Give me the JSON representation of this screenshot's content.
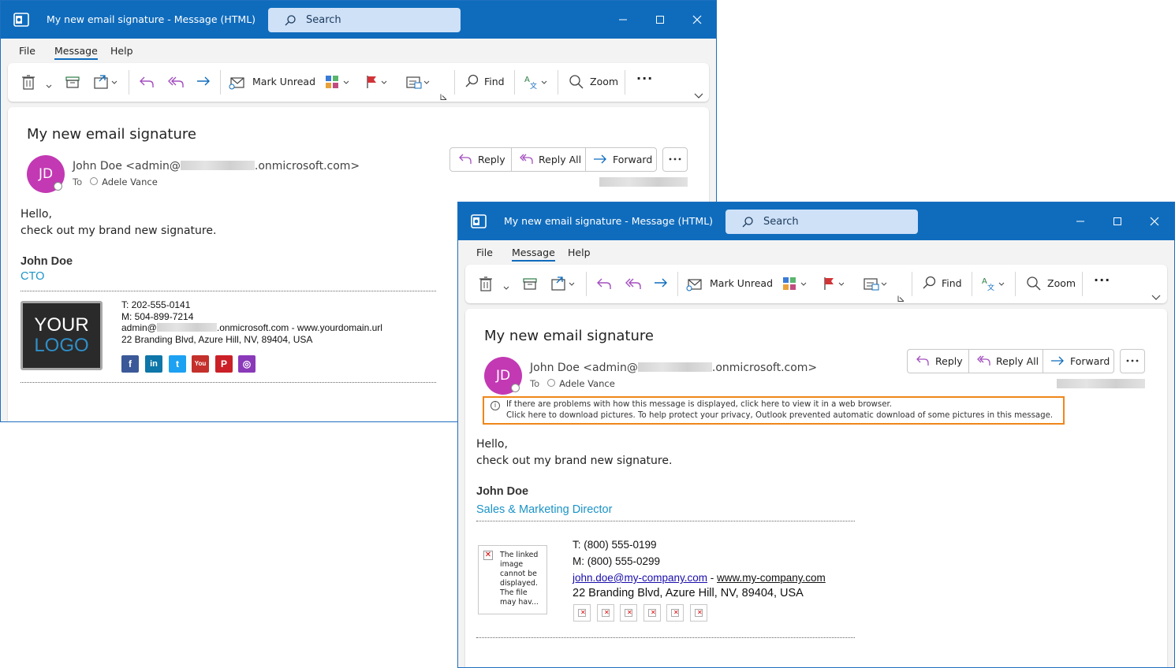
{
  "window1": {
    "title": "My new email signature  -  Message (HTML)",
    "search_placeholder": "Search",
    "menu": [
      "File",
      "Message",
      "Help"
    ],
    "ribbon": {
      "mark_unread": "Mark Unread",
      "find": "Find",
      "zoom": "Zoom",
      "more": "···"
    },
    "subject": "My new email signature",
    "avatar_initials": "JD",
    "sender_prefix": "John Doe <admin@",
    "sender_suffix": ".onmicrosoft.com>",
    "to_label": "To",
    "recipient": "Adele Vance",
    "actions": {
      "reply": "Reply",
      "reply_all": "Reply All",
      "forward": "Forward"
    },
    "body": [
      "Hello,",
      "check out my brand new signature."
    ],
    "signature": {
      "name": "John Doe",
      "title": "CTO",
      "logo_line1": "YOUR",
      "logo_line2": "LOGO",
      "phone": "T: 202-555-0141",
      "mobile": "M: 504-899-7214",
      "email_prefix": "admin@",
      "email_suffix": ".onmicrosoft.com - www.yourdomain.url",
      "address": "22 Branding Blvd, Azure Hill, NV, 89404, USA",
      "social": [
        {
          "name": "facebook",
          "glyph": "f",
          "color": "#3b5998"
        },
        {
          "name": "linkedin",
          "glyph": "in",
          "color": "#0e76a8"
        },
        {
          "name": "twitter",
          "glyph": "t",
          "color": "#1da1f2"
        },
        {
          "name": "youtube",
          "glyph": "You",
          "color": "#c4302b"
        },
        {
          "name": "pinterest",
          "glyph": "P",
          "color": "#cb2027"
        },
        {
          "name": "instagram",
          "glyph": "◎",
          "color": "#8a3ab9"
        }
      ]
    }
  },
  "window2": {
    "title": "My new email signature  -  Message (HTML)",
    "search_placeholder": "Search",
    "menu": [
      "File",
      "Message",
      "Help"
    ],
    "ribbon": {
      "mark_unread": "Mark Unread",
      "find": "Find",
      "zoom": "Zoom",
      "more": "···"
    },
    "subject": "My new email signature",
    "avatar_initials": "JD",
    "sender_prefix": "John Doe <admin@",
    "sender_suffix": ".onmicrosoft.com>",
    "to_label": "To",
    "recipient": "Adele Vance",
    "actions": {
      "reply": "Reply",
      "reply_all": "Reply All",
      "forward": "Forward"
    },
    "infobar": {
      "line1": "If there are problems with how this message is displayed, click here to view it in a web browser.",
      "line2": "Click here to download pictures. To help protect your privacy, Outlook prevented automatic download of some pictures in this message."
    },
    "body": [
      "Hello,",
      "check out my brand new signature."
    ],
    "signature": {
      "name": "John Doe",
      "title": "Sales & Marketing Director",
      "broken_image_text": "The linked\nimage\ncannot be\ndisplayed.\nThe file\nmay  hav...",
      "phone": "T: (800) 555-0199",
      "mobile": "M: (800) 555-0299",
      "email": "john.doe@my-company.com",
      "separator": " - ",
      "website": "www.my-company.com",
      "address": "22 Branding Blvd, Azure Hill, NV, 89404, USA"
    }
  },
  "colors": {
    "titlebar": "#0f6cbd",
    "avatar": "#c239b3",
    "accent_title": "#1b93c7",
    "highlight": "#f0861a"
  }
}
